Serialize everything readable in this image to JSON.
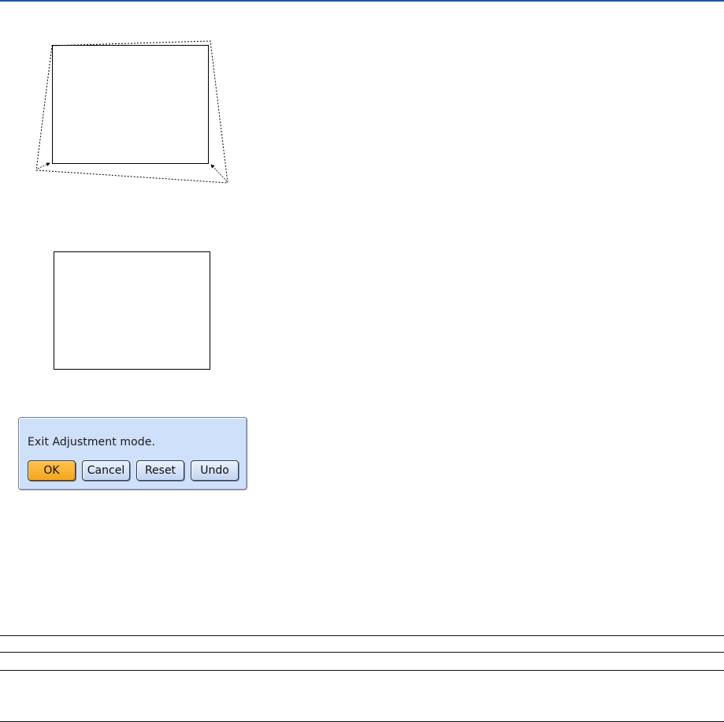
{
  "dialog": {
    "message": "Exit Adjustment mode.",
    "buttons": {
      "ok": "OK",
      "cancel": "Cancel",
      "reset": "Reset",
      "undo": "Undo"
    },
    "colors": {
      "background": "#cfe0fb",
      "selected_button": "#f5a51d"
    }
  },
  "accent_color": "#1f56a6",
  "figures": [
    {
      "name": "keystone-distorted-projection"
    },
    {
      "name": "corrected-projection-screen"
    }
  ]
}
